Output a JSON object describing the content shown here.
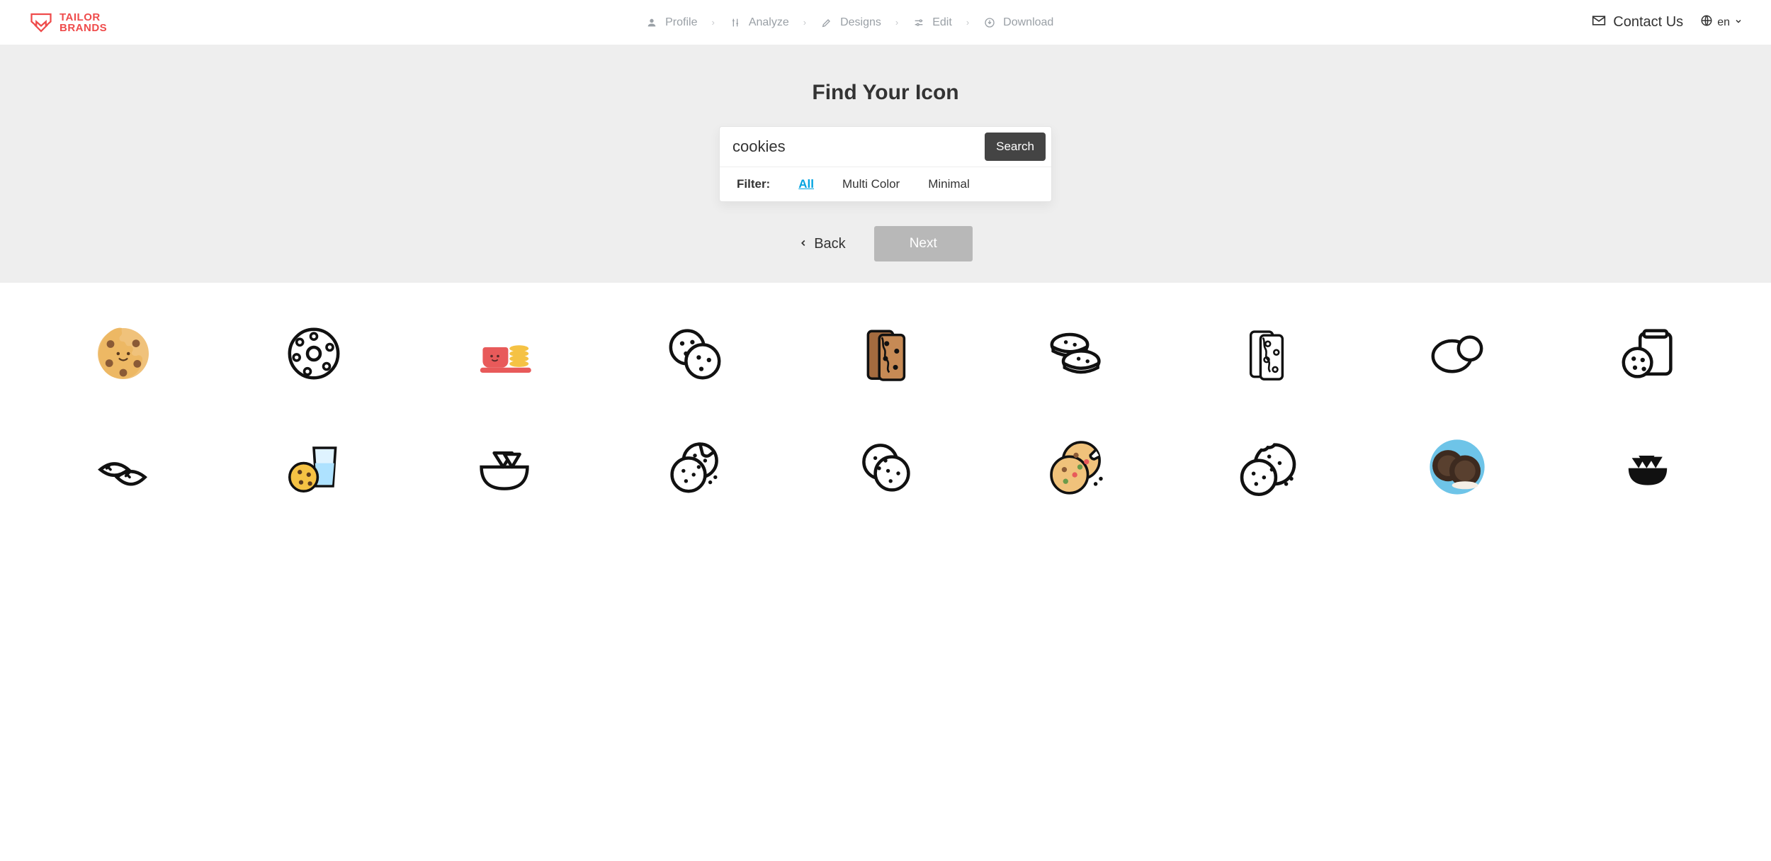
{
  "brand": {
    "name_top": "TAILOR",
    "name_bottom": "BRANDS",
    "accent": "#ef4b4b"
  },
  "steps": [
    {
      "label": "Profile",
      "active": false
    },
    {
      "label": "Analyze",
      "active": false
    },
    {
      "label": "Designs",
      "active": false
    },
    {
      "label": "Edit",
      "active": false
    },
    {
      "label": "Download",
      "active": false
    }
  ],
  "header": {
    "contact_label": "Contact Us",
    "lang_code": "en"
  },
  "hero": {
    "title": "Find Your Icon",
    "search_value": "cookies",
    "search_button": "Search",
    "filter_label": "Filter:",
    "filters": [
      {
        "label": "All",
        "active": true
      },
      {
        "label": "Multi Color",
        "active": false
      },
      {
        "label": "Minimal",
        "active": false
      }
    ],
    "back_label": "Back",
    "next_label": "Next"
  },
  "icons": [
    {
      "name": "cookie-cartoon-color"
    },
    {
      "name": "cookie-donut-outline"
    },
    {
      "name": "cup-and-cookies-color"
    },
    {
      "name": "cookies-pair-outline"
    },
    {
      "name": "cookie-bars-color"
    },
    {
      "name": "sandwich-cookies-outline"
    },
    {
      "name": "cookie-bars-outline"
    },
    {
      "name": "cookies-simple-outline"
    },
    {
      "name": "cookie-jar-outline"
    },
    {
      "name": "fortune-cookies-outline"
    },
    {
      "name": "cookie-and-milk-color"
    },
    {
      "name": "chips-bowl-outline"
    },
    {
      "name": "cookies-dots-outline"
    },
    {
      "name": "cookies-stacked-outline"
    },
    {
      "name": "chocolate-chip-color"
    },
    {
      "name": "cookie-bite-outline"
    },
    {
      "name": "oreo-cookies-color"
    },
    {
      "name": "nacho-bowl-solid"
    }
  ]
}
